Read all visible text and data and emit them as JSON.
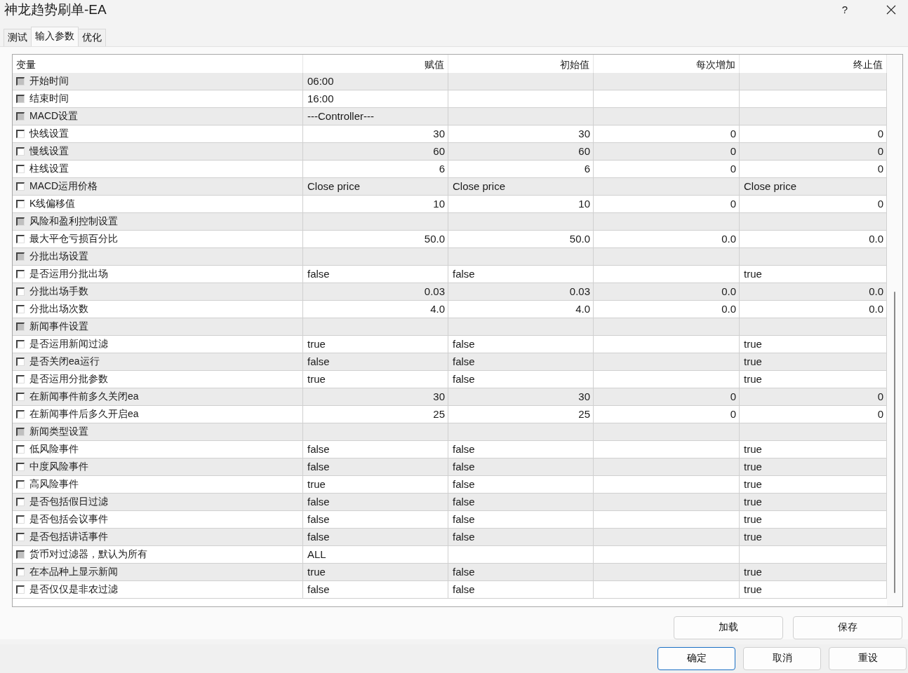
{
  "window": {
    "title": "神龙趋势刷单-EA",
    "help": "?"
  },
  "tabs": [
    {
      "label": "测试",
      "selected": false
    },
    {
      "label": "输入参数",
      "selected": true
    },
    {
      "label": "优化",
      "selected": false
    }
  ],
  "table": {
    "columns": [
      "变量",
      "赋值",
      "初始值",
      "每次增加",
      "终止值"
    ],
    "rows": [
      {
        "name": "开始时间",
        "disabled": true,
        "kind": "text",
        "value": "06:00"
      },
      {
        "name": "结束时间",
        "disabled": true,
        "kind": "text",
        "value": "16:00"
      },
      {
        "name": "MACD设置",
        "disabled": true,
        "kind": "text",
        "value": "---Controller---"
      },
      {
        "name": "快线设置",
        "disabled": false,
        "kind": "number",
        "value": "30",
        "start": "30",
        "step": "0",
        "stop": "0"
      },
      {
        "name": "慢线设置",
        "disabled": false,
        "kind": "number",
        "value": "60",
        "start": "60",
        "step": "0",
        "stop": "0"
      },
      {
        "name": "柱线设置",
        "disabled": false,
        "kind": "number",
        "value": "6",
        "start": "6",
        "step": "0",
        "stop": "0"
      },
      {
        "name": "MACD运用价格",
        "disabled": false,
        "kind": "text",
        "value": "Close price",
        "start": "Close price",
        "stop": "Close price"
      },
      {
        "name": "K线偏移值",
        "disabled": false,
        "kind": "number",
        "value": "10",
        "start": "10",
        "step": "0",
        "stop": "0"
      },
      {
        "name": "风险和盈利控制设置",
        "disabled": true,
        "kind": "text"
      },
      {
        "name": "最大平仓亏损百分比",
        "disabled": false,
        "kind": "number",
        "value": "50.0",
        "start": "50.0",
        "step": "0.0",
        "stop": "0.0"
      },
      {
        "name": "分批出场设置",
        "disabled": true,
        "kind": "text"
      },
      {
        "name": "是否运用分批出场",
        "disabled": false,
        "kind": "text",
        "value": "false",
        "start": "false",
        "stop": "true"
      },
      {
        "name": "分批出场手数",
        "disabled": false,
        "kind": "number",
        "value": "0.03",
        "start": "0.03",
        "step": "0.0",
        "stop": "0.0"
      },
      {
        "name": "分批出场次数",
        "disabled": false,
        "kind": "number",
        "value": "4.0",
        "start": "4.0",
        "step": "0.0",
        "stop": "0.0"
      },
      {
        "name": "新闻事件设置",
        "disabled": true,
        "kind": "text"
      },
      {
        "name": "是否运用新闻过滤",
        "disabled": false,
        "kind": "text",
        "value": "true",
        "start": "false",
        "stop": "true"
      },
      {
        "name": "是否关闭ea运行",
        "disabled": false,
        "kind": "text",
        "value": "false",
        "start": "false",
        "stop": "true"
      },
      {
        "name": "是否运用分批参数",
        "disabled": false,
        "kind": "text",
        "value": "true",
        "start": "false",
        "stop": "true"
      },
      {
        "name": "在新闻事件前多久关闭ea",
        "disabled": false,
        "kind": "number",
        "value": "30",
        "start": "30",
        "step": "0",
        "stop": "0"
      },
      {
        "name": "在新闻事件后多久开启ea",
        "disabled": false,
        "kind": "number",
        "value": "25",
        "start": "25",
        "step": "0",
        "stop": "0"
      },
      {
        "name": "新闻类型设置",
        "disabled": true,
        "kind": "text"
      },
      {
        "name": "低风险事件",
        "disabled": false,
        "kind": "text",
        "value": "false",
        "start": "false",
        "stop": "true"
      },
      {
        "name": "中度风险事件",
        "disabled": false,
        "kind": "text",
        "value": "false",
        "start": "false",
        "stop": "true"
      },
      {
        "name": "高风险事件",
        "disabled": false,
        "kind": "text",
        "value": "true",
        "start": "false",
        "stop": "true"
      },
      {
        "name": "是否包括假日过滤",
        "disabled": false,
        "kind": "text",
        "value": "false",
        "start": "false",
        "stop": "true"
      },
      {
        "name": "是否包括会议事件",
        "disabled": false,
        "kind": "text",
        "value": "false",
        "start": "false",
        "stop": "true"
      },
      {
        "name": "是否包括讲话事件",
        "disabled": false,
        "kind": "text",
        "value": "false",
        "start": "false",
        "stop": "true"
      },
      {
        "name": "货币对过滤器，默认为所有",
        "disabled": true,
        "kind": "text",
        "value": "ALL"
      },
      {
        "name": "在本品种上显示新闻",
        "disabled": false,
        "kind": "text",
        "value": "true",
        "start": "false",
        "stop": "true"
      },
      {
        "name": "是否仅仅是非农过滤",
        "disabled": false,
        "kind": "text",
        "value": "false",
        "start": "false",
        "stop": "true"
      }
    ]
  },
  "file_buttons": [
    "加载",
    "保存"
  ],
  "dialog_buttons": [
    {
      "label": "确定",
      "focused": true
    },
    {
      "label": "取消",
      "focused": false
    },
    {
      "label": "重设",
      "focused": false
    }
  ]
}
